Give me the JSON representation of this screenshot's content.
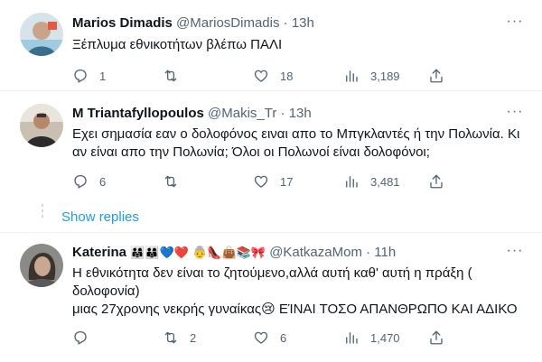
{
  "tweets": [
    {
      "name": "Marios Dimadis",
      "handle": "@MariosDimadis",
      "dot": "·",
      "time": "13h",
      "text": "Ξέπλυμα εθνικοτήτων βλέπω ΠΑΛΙ",
      "reply_count": "1",
      "retweet_count": "",
      "like_count": "18",
      "view_count": "3,189",
      "more": "···"
    },
    {
      "name": "M Triantafyllopoulos",
      "handle": "@Makis_Tr",
      "dot": "·",
      "time": "13h",
      "text_line1": "Εχει σημασία εαν ο δολοφόνος ειναι απο το Μπγκλαντές ή την Πολωνία. Κι",
      "text_line2": "αν είναι απο την Πολωνία; Όλοι οι Πολωνοί είναι δολοφόνοι;",
      "reply_count": "6",
      "retweet_count": "",
      "like_count": "17",
      "view_count": "3,481",
      "more": "···"
    },
    {
      "name": "Katerina",
      "name_emojis": "👨‍👩‍👧👨‍👩‍👦💙❤️ 👵👠👜📚🎀",
      "handle": "@KatkazaMom",
      "dot": "·",
      "time": "11h",
      "text_line1": "Η εθνικότητα δεν είναι το ζητούμενο,αλλά αυτή καθ' αυτή η πράξη (",
      "text_line2": "δολοφονία)",
      "text_line3": "μιας 27χρονης νεκρής γυναίκας😢 ΕΊΝΑΙ ΤΟΣΟ ΑΠΑΝΘΡΩΠΟ ΚΑΙ ΑΔΙΚΟ",
      "reply_count": "",
      "retweet_count": "2",
      "like_count": "6",
      "view_count": "1,470",
      "more": "···"
    }
  ],
  "show_replies": "Show replies",
  "icons": [
    "reply-icon",
    "retweet-icon",
    "like-icon",
    "views-icon",
    "share-icon"
  ],
  "colors": {
    "accent": "#1d9bf0",
    "muted": "#536471",
    "text": "#0f1419",
    "line": "#cfd9de"
  }
}
